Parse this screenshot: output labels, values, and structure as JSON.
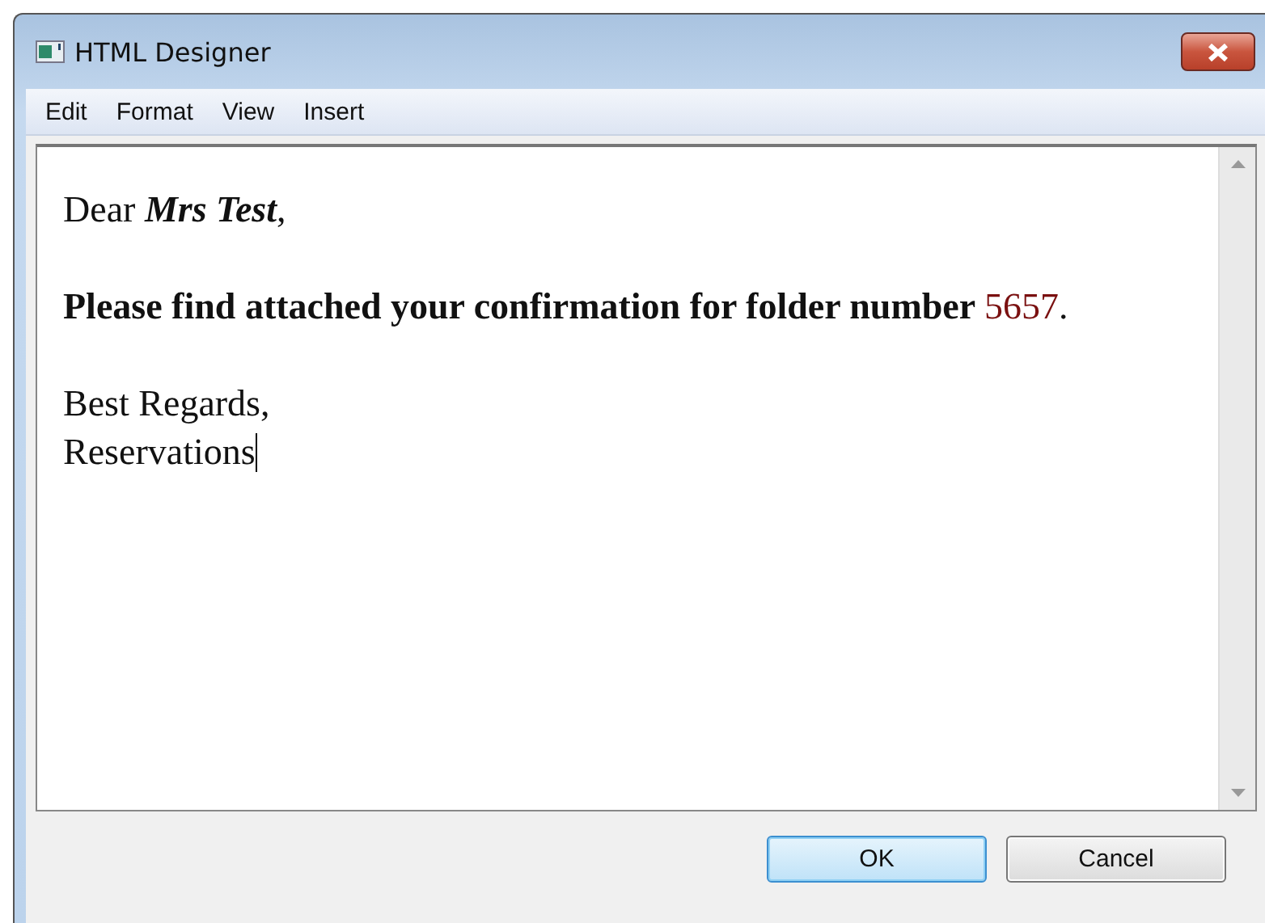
{
  "window": {
    "title": "HTML Designer"
  },
  "menu": [
    "Edit",
    "Format",
    "View",
    "Insert"
  ],
  "editor": {
    "paragraphs": [
      {
        "lines": [
          {
            "segments": [
              {
                "text": "Dear ",
                "bold": false,
                "italic": false
              },
              {
                "text": "Mrs Test",
                "bold": true,
                "italic": true
              },
              {
                "text": ",",
                "bold": false,
                "italic": false
              }
            ]
          }
        ]
      },
      {
        "lines": [
          {
            "segments": [
              {
                "text": "Please find attached your confirmation for folder number ",
                "bold": true,
                "italic": false
              },
              {
                "text": "5657",
                "bold": false,
                "italic": false,
                "color": "#7a1010"
              },
              {
                "text": ".",
                "bold": false,
                "italic": false
              }
            ]
          }
        ]
      },
      {
        "lines": [
          {
            "segments": [
              {
                "text": "Best Regards,",
                "bold": false,
                "italic": false
              }
            ]
          },
          {
            "cursor": true,
            "segments": [
              {
                "text": "Reservations",
                "bold": false,
                "italic": false
              }
            ]
          }
        ]
      }
    ]
  },
  "buttons": [
    {
      "label": "OK",
      "default": true
    },
    {
      "label": "Cancel",
      "default": false
    }
  ]
}
